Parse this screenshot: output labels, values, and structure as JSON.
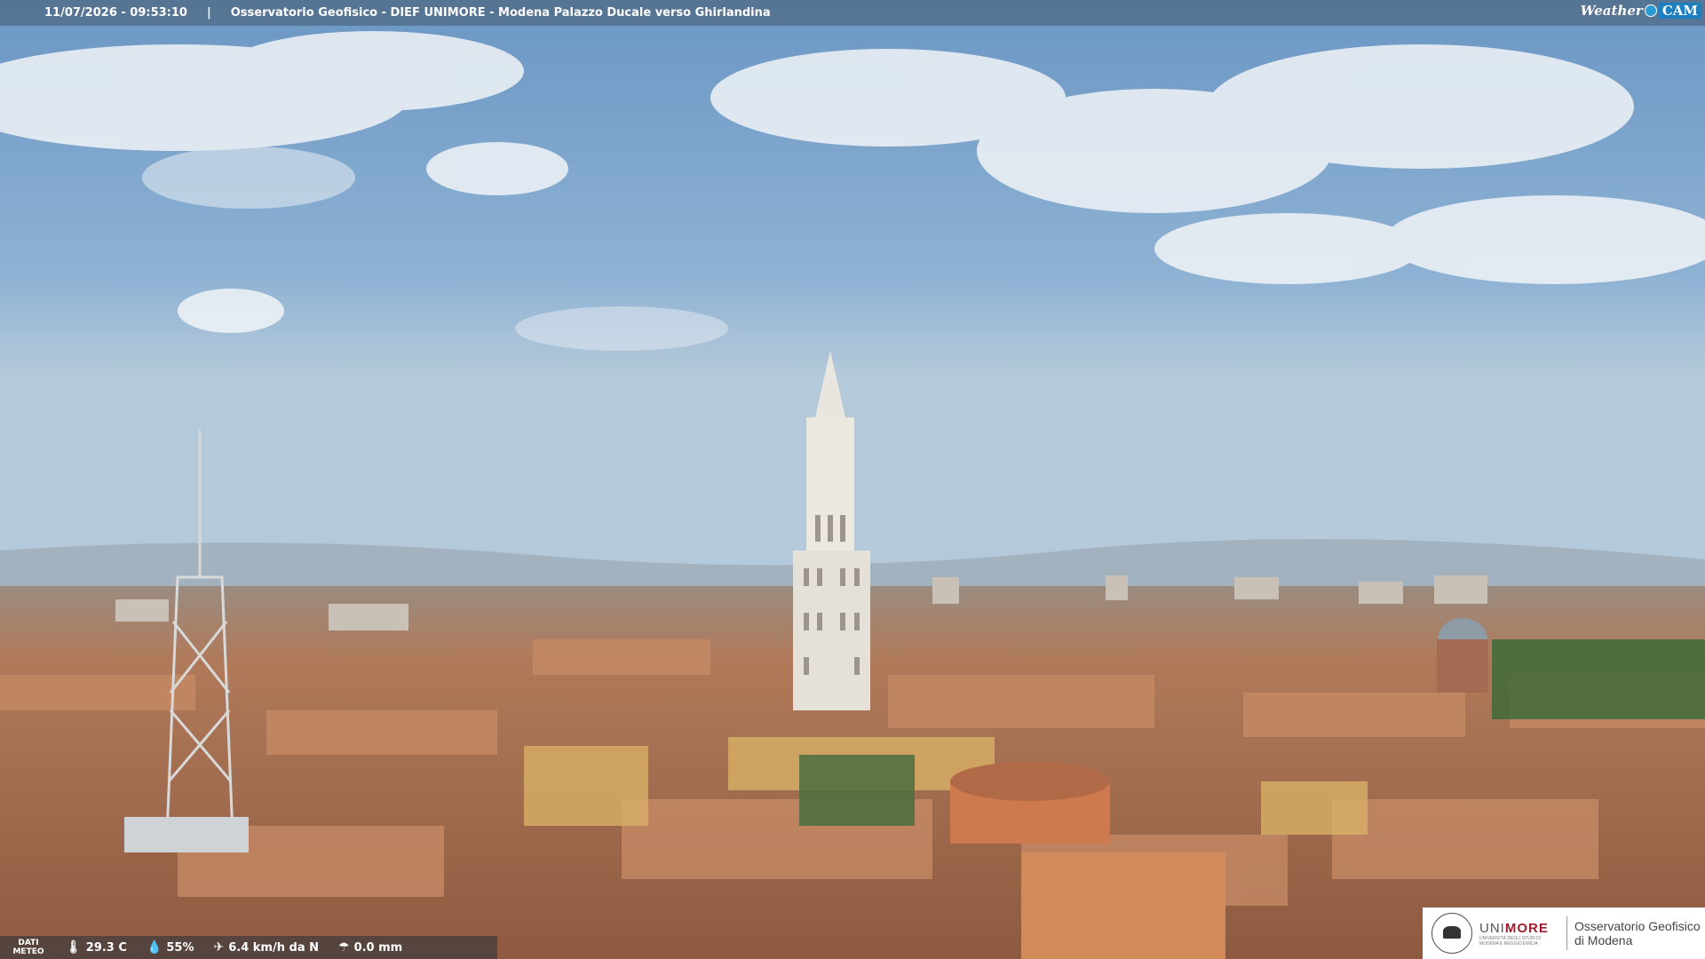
{
  "header": {
    "timestamp": "11/07/2026 - 09:53:10",
    "separator": "|",
    "title": "Osservatorio Geofisico - DIEF UNIMORE - Modena Palazzo Ducale verso Ghirlandina"
  },
  "logo": {
    "weather": "Weather",
    "cam": "CAM"
  },
  "meteo": {
    "label": "DATI METEO",
    "temperature": "29.3 C",
    "humidity": "55%",
    "wind": "6.4 km/h da N",
    "rain": "0.0 mm",
    "icons": [
      "thermometer-icon",
      "humidity-drop-icon",
      "wind-icon",
      "rain-gauge-icon"
    ]
  },
  "branding": {
    "university_prefix": "UNI",
    "university_suffix": "MORE",
    "university_sub": "UNIVERSITÀ DEGLI STUDI DI MODENA E REGGIO EMILIA",
    "observatory_line1": "Osservatorio Geofisico",
    "observatory_line2": "di Modena"
  },
  "colors": {
    "sky": "#7fa6cc",
    "roofs": "#b0714f",
    "tower": "#e8e4dc",
    "accent": "#a01c2c"
  }
}
